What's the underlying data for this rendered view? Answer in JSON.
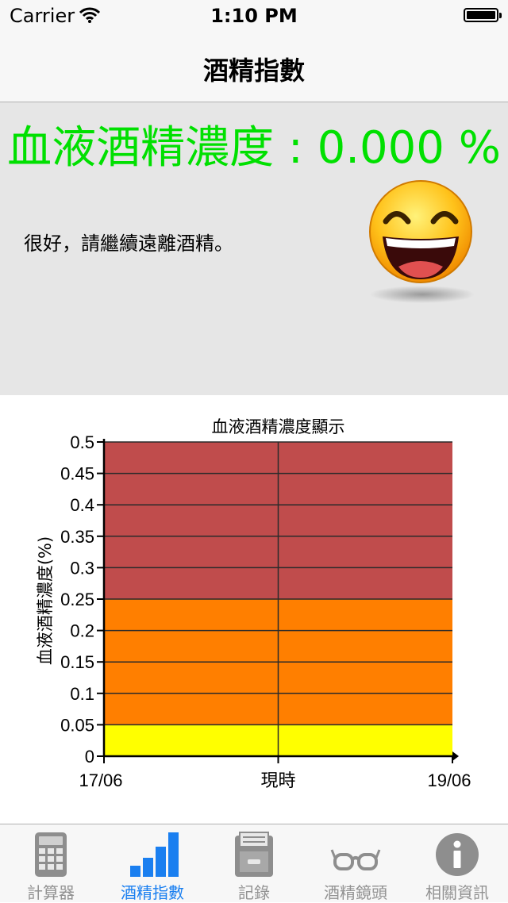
{
  "status_bar": {
    "carrier": "Carrier",
    "time": "1:10 PM"
  },
  "nav": {
    "title": "酒精指數"
  },
  "result": {
    "label": "血液酒精濃度",
    "separator": ":",
    "value": "0.000",
    "unit": "%",
    "message": "很好，請繼續遠離酒精。",
    "face_icon": "laughing-face-icon",
    "value_color": "#00e000"
  },
  "chart_data": {
    "type": "area",
    "title": "血液酒精濃度顯示",
    "ylabel": "血液酒精濃度(%)",
    "xlabel": "",
    "x_ticks": [
      "17/06",
      "現時",
      "19/06"
    ],
    "y_ticks": [
      "0",
      "0.05",
      "0.1",
      "0.15",
      "0.2",
      "0.25",
      "0.3",
      "0.35",
      "0.4",
      "0.45",
      "0.5"
    ],
    "ylim": [
      0,
      0.5
    ],
    "grid": true,
    "bands": [
      {
        "from": 0,
        "to": 0.05,
        "color": "#ffff00"
      },
      {
        "from": 0.05,
        "to": 0.25,
        "color": "#ff7f00"
      },
      {
        "from": 0.25,
        "to": 0.5,
        "color": "#c04c4c"
      }
    ],
    "series": [
      {
        "values": [
          0,
          0,
          0
        ]
      }
    ]
  },
  "tabs": [
    {
      "label": "計算器",
      "icon": "calculator-icon",
      "active": false
    },
    {
      "label": "酒精指數",
      "icon": "bar-chart-icon",
      "active": true
    },
    {
      "label": "記錄",
      "icon": "file-cabinet-icon",
      "active": false
    },
    {
      "label": "酒精鏡頭",
      "icon": "glasses-icon",
      "active": false
    },
    {
      "label": "相關資訊",
      "icon": "info-icon",
      "active": false
    }
  ]
}
